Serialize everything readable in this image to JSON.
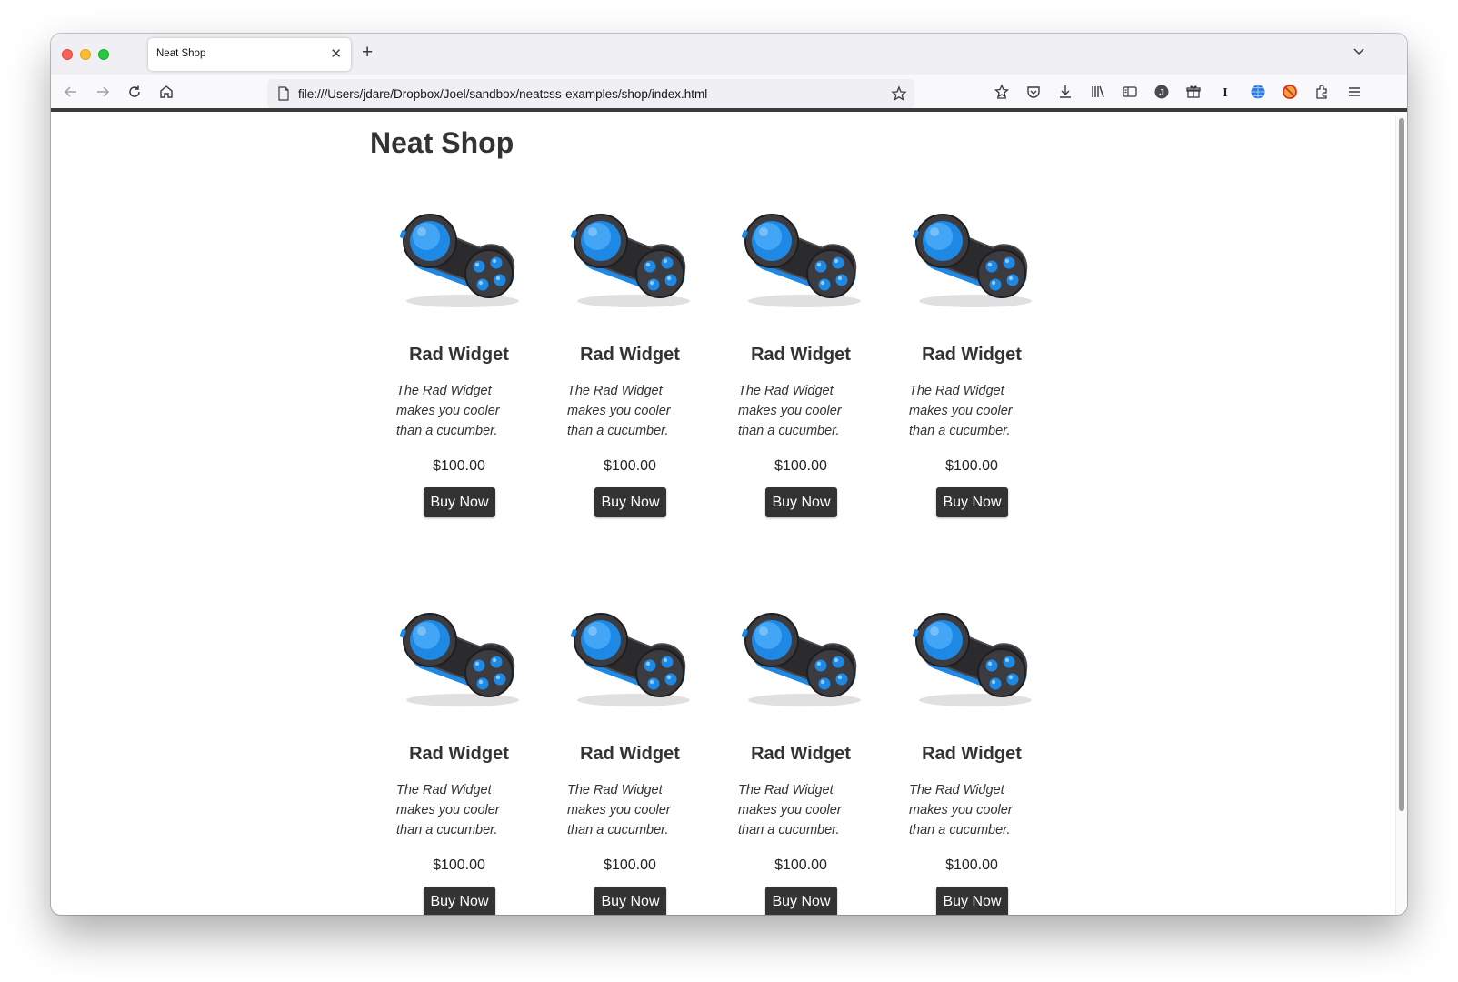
{
  "browser": {
    "tab_title": "Neat Shop",
    "url": "file:///Users/jdare/Dropbox/Joel/sandbox/neatcss-examples/shop/index.html",
    "icons": [
      "back-icon",
      "forward-icon",
      "reload-icon",
      "home-icon",
      "page-icon",
      "bookmark-star-icon",
      "pocket-save-icon",
      "pocket-icon",
      "downloads-icon",
      "library-icon",
      "sidebar-icon",
      "account-icon",
      "gift-icon",
      "extension-i-icon",
      "extension-globe-icon",
      "extension-blocked-icon",
      "extensions-icon",
      "menu-icon"
    ]
  },
  "page": {
    "title": "Neat Shop",
    "accent_color": "#333333",
    "products": [
      {
        "name": "Rad Widget",
        "description": "The Rad Widget makes you cooler than a cucumber.",
        "price": "$100.00",
        "button": "Buy Now"
      },
      {
        "name": "Rad Widget",
        "description": "The Rad Widget makes you cooler than a cucumber.",
        "price": "$100.00",
        "button": "Buy Now"
      },
      {
        "name": "Rad Widget",
        "description": "The Rad Widget makes you cooler than a cucumber.",
        "price": "$100.00",
        "button": "Buy Now"
      },
      {
        "name": "Rad Widget",
        "description": "The Rad Widget makes you cooler than a cucumber.",
        "price": "$100.00",
        "button": "Buy Now"
      },
      {
        "name": "Rad Widget",
        "description": "The Rad Widget makes you cooler than a cucumber.",
        "price": "$100.00",
        "button": "Buy Now"
      },
      {
        "name": "Rad Widget",
        "description": "The Rad Widget makes you cooler than a cucumber.",
        "price": "$100.00",
        "button": "Buy Now"
      },
      {
        "name": "Rad Widget",
        "description": "The Rad Widget makes you cooler than a cucumber.",
        "price": "$100.00",
        "button": "Buy Now"
      },
      {
        "name": "Rad Widget",
        "description": "The Rad Widget makes you cooler than a cucumber.",
        "price": "$100.00",
        "button": "Buy Now"
      }
    ]
  }
}
